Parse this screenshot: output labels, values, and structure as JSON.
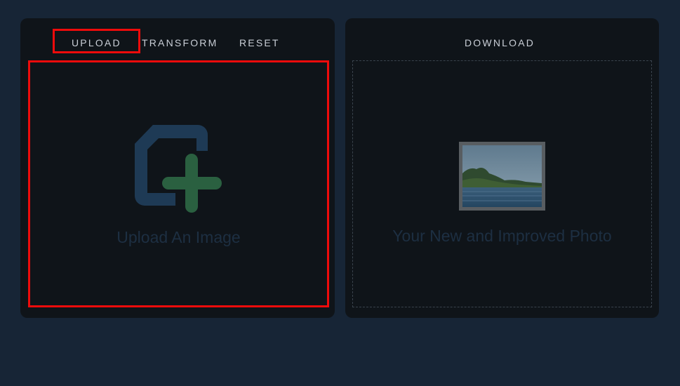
{
  "left_panel": {
    "nav": {
      "upload": "UPLOAD",
      "transform": "TRANSFORM",
      "reset": "RESET"
    },
    "dropzone_text": "Upload An Image",
    "icon": "file-add-icon"
  },
  "right_panel": {
    "nav": {
      "download": "DOWNLOAD"
    },
    "preview_text": "Your New and Improved Photo",
    "icon": "landscape-photo-icon"
  },
  "colors": {
    "background": "#172536",
    "panel": "#0f1419",
    "highlight": "#ee0b0b",
    "file_icon": "#1e3a55",
    "plus_icon": "#2a6040",
    "placeholder_text": "#1d2f42"
  }
}
